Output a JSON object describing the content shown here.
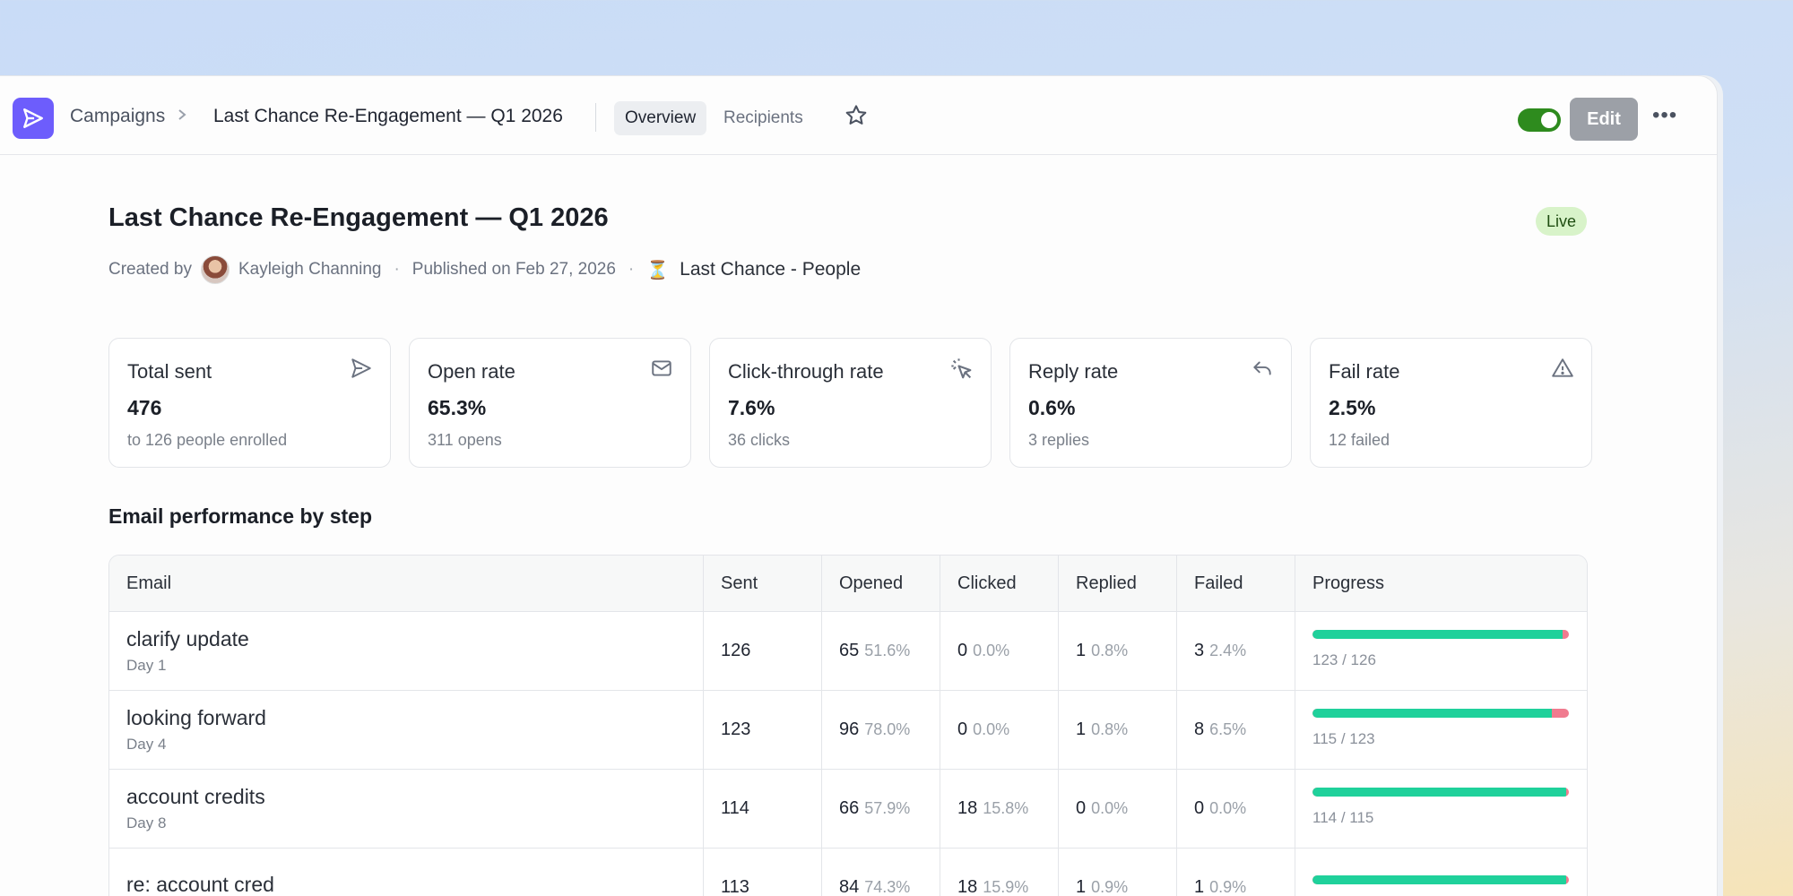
{
  "breadcrumb": {
    "root": "Campaigns",
    "current": "Last Chance Re-Engagement — Q1 2026"
  },
  "tabs": [
    {
      "label": "Overview",
      "active": true
    },
    {
      "label": "Recipients",
      "active": false
    }
  ],
  "toolbar": {
    "edit_label": "Edit",
    "toggle_on": true,
    "more_label": "•••"
  },
  "header": {
    "title": "Last Chance Re-Engagement — Q1 2026",
    "status": "Live",
    "created_by_label": "Created by",
    "author": "Kayleigh Channing",
    "published": "Published on Feb 27, 2026",
    "audience": "Last Chance - People"
  },
  "stats": [
    {
      "label": "Total sent",
      "value": "476",
      "sub": "to 126 people enrolled",
      "icon": "send-icon"
    },
    {
      "label": "Open rate",
      "value": "65.3%",
      "sub": "311 opens",
      "icon": "mail-icon"
    },
    {
      "label": "Click-through rate",
      "value": "7.6%",
      "sub": "36 clicks",
      "icon": "cursor-click-icon"
    },
    {
      "label": "Reply rate",
      "value": "0.6%",
      "sub": "3 replies",
      "icon": "reply-icon"
    },
    {
      "label": "Fail rate",
      "value": "2.5%",
      "sub": "12 failed",
      "icon": "warning-icon"
    }
  ],
  "table": {
    "title": "Email performance by step",
    "columns": [
      "Email",
      "Sent",
      "Opened",
      "Clicked",
      "Replied",
      "Failed",
      "Progress"
    ],
    "rows": [
      {
        "subject": "clarify update",
        "day": "Day 1",
        "sent": "126",
        "opened": "65",
        "opened_pct": "51.6%",
        "clicked": "0",
        "clicked_pct": "0.0%",
        "replied": "1",
        "replied_pct": "0.8%",
        "failed": "3",
        "failed_pct": "2.4%",
        "progress_label": "123 / 126",
        "progress": 0.976
      },
      {
        "subject": "looking forward",
        "day": "Day 4",
        "sent": "123",
        "opened": "96",
        "opened_pct": "78.0%",
        "clicked": "0",
        "clicked_pct": "0.0%",
        "replied": "1",
        "replied_pct": "0.8%",
        "failed": "8",
        "failed_pct": "6.5%",
        "progress_label": "115 / 123",
        "progress": 0.935
      },
      {
        "subject": "account credits",
        "day": "Day 8",
        "sent": "114",
        "opened": "66",
        "opened_pct": "57.9%",
        "clicked": "18",
        "clicked_pct": "15.8%",
        "replied": "0",
        "replied_pct": "0.0%",
        "failed": "0",
        "failed_pct": "0.0%",
        "progress_label": "114 / 115",
        "progress": 0.991
      },
      {
        "subject": "re: account cred",
        "day": "",
        "sent": "113",
        "opened": "84",
        "opened_pct": "74.3%",
        "clicked": "18",
        "clicked_pct": "15.9%",
        "replied": "1",
        "replied_pct": "0.9%",
        "failed": "1",
        "failed_pct": "0.9%",
        "progress_label": "",
        "progress": 0.99
      }
    ]
  },
  "colors": {
    "brand": "#6d5dfc",
    "progress_ok": "#1fd19b",
    "progress_fail": "#f07b8f",
    "live_badge_bg": "#d8f3c9",
    "toggle_on": "#2e8b1e"
  }
}
